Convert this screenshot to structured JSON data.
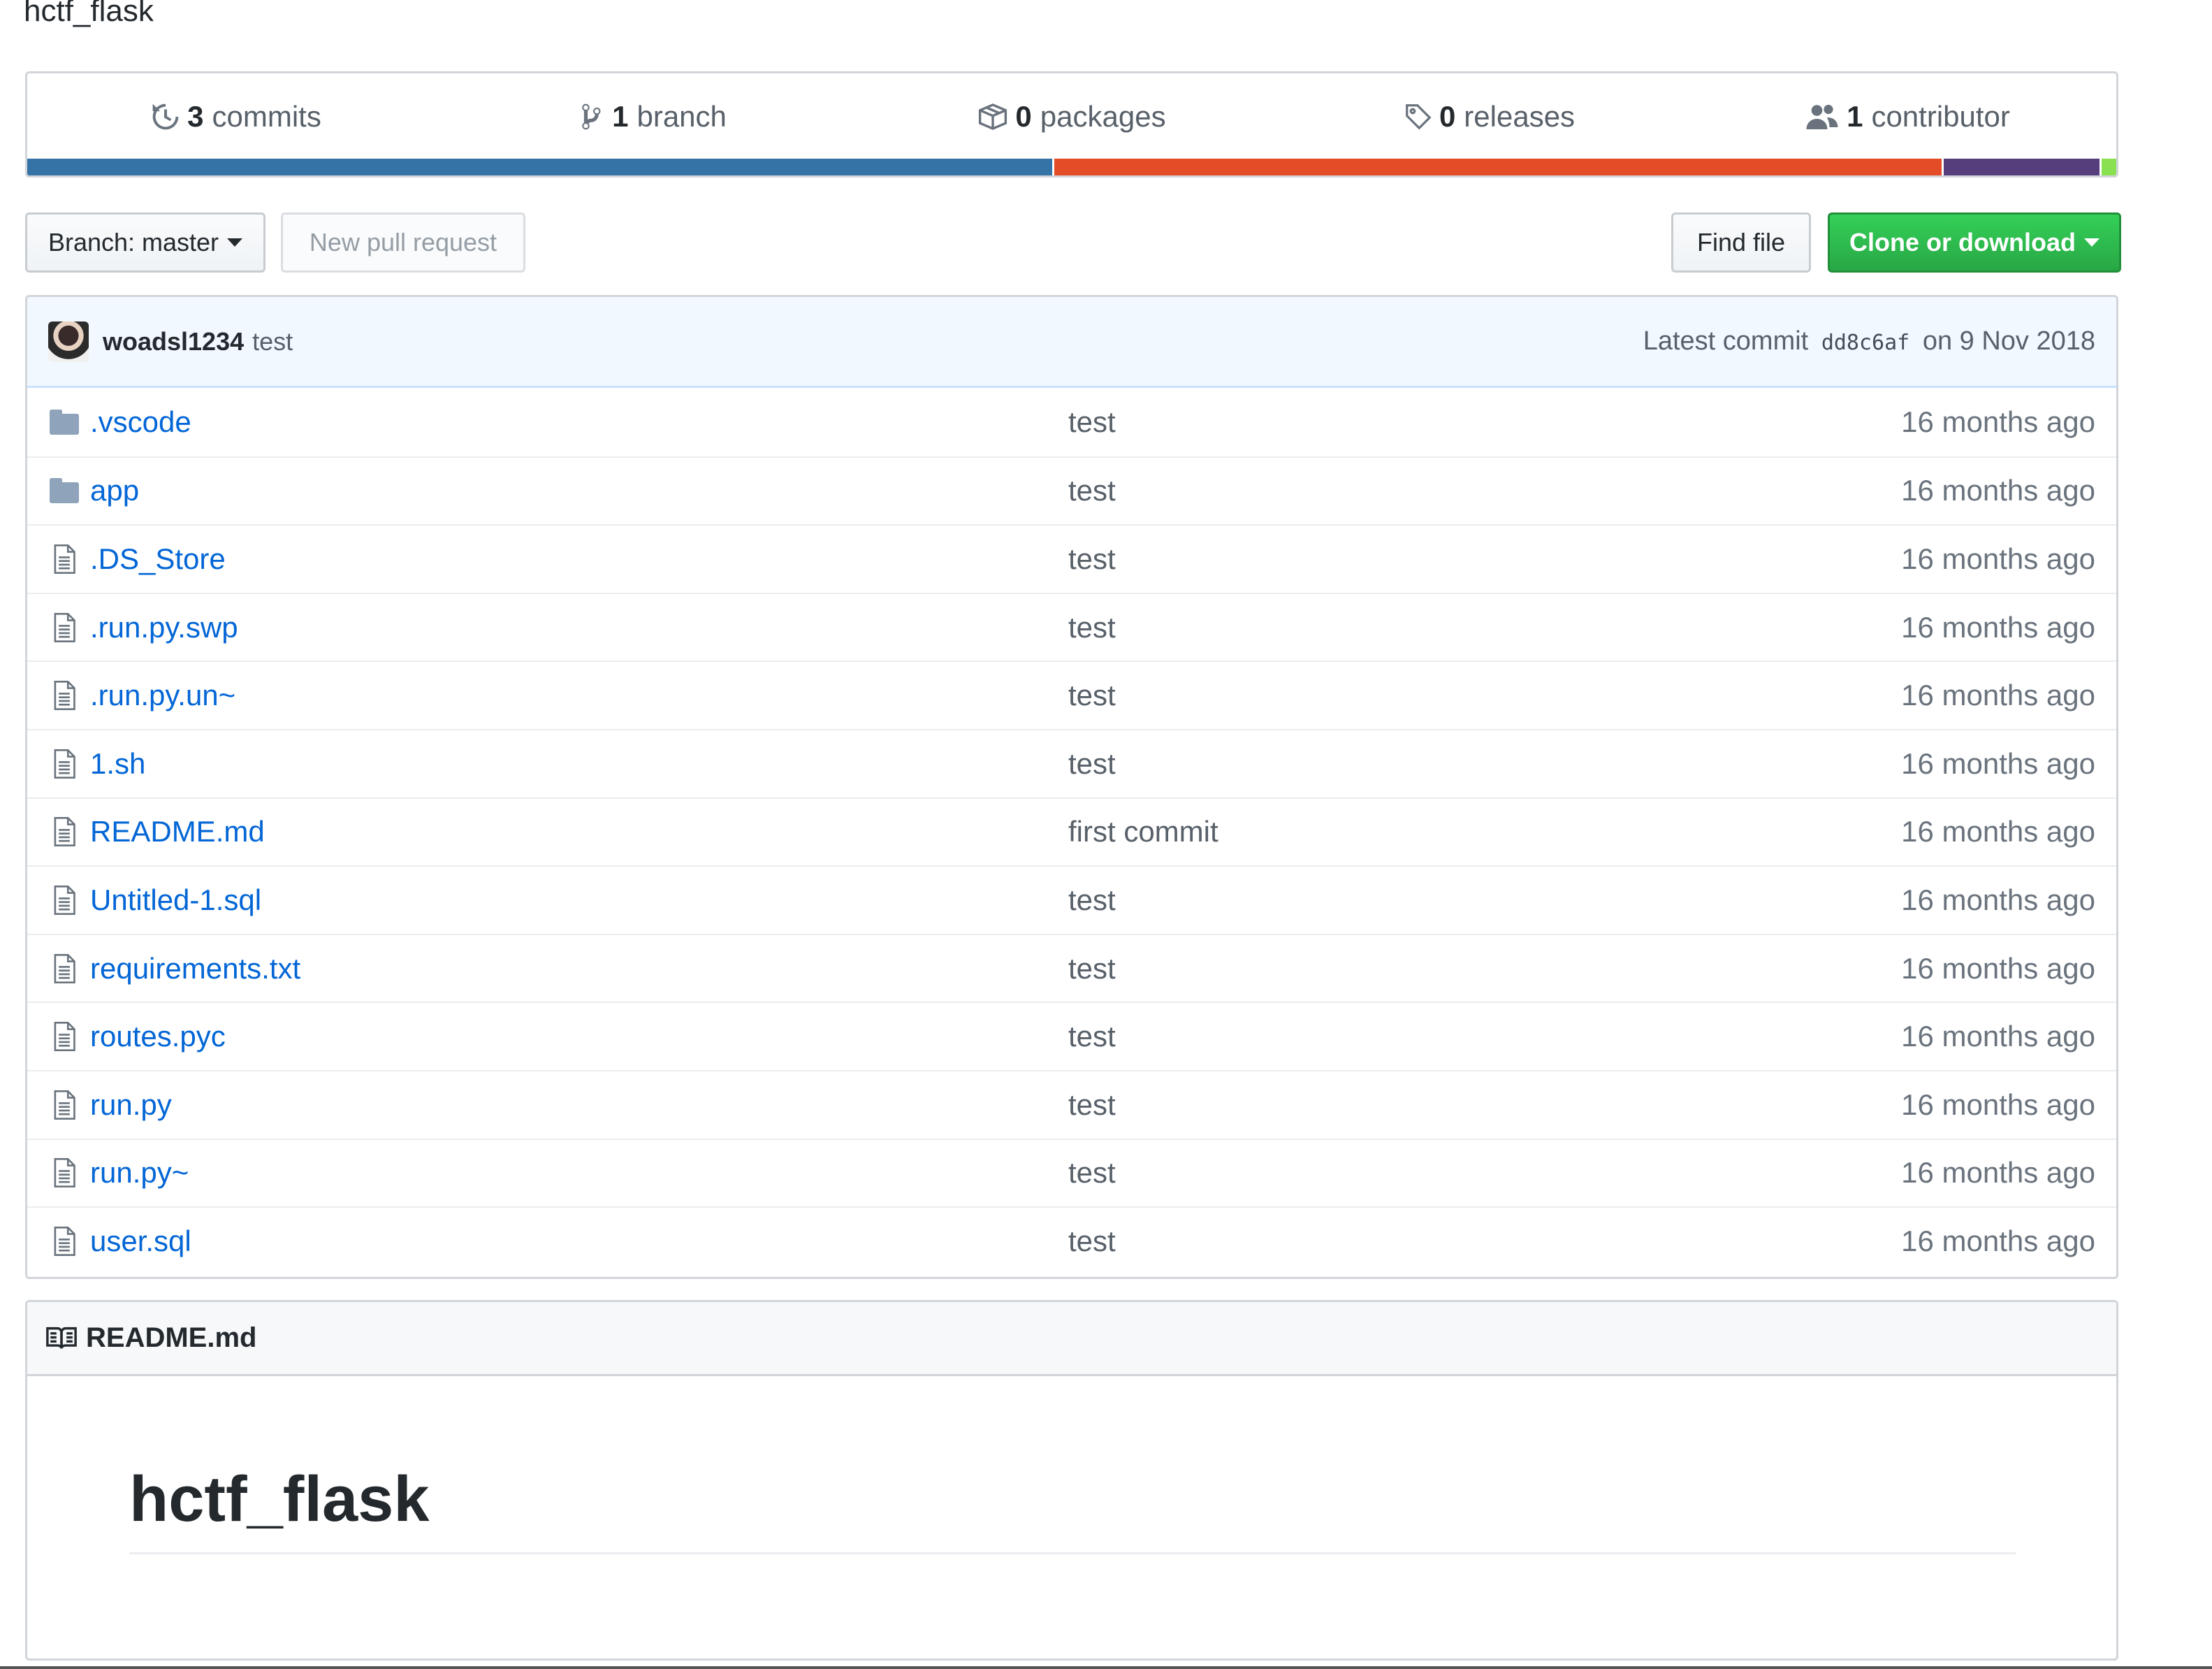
{
  "repo": {
    "description": "hctf_flask"
  },
  "summary": {
    "commits": {
      "count": "3",
      "label": "commits"
    },
    "branches": {
      "count": "1",
      "label": "branch"
    },
    "packages": {
      "count": "0",
      "label": "packages"
    },
    "releases": {
      "count": "0",
      "label": "releases"
    },
    "contributors": {
      "count": "1",
      "label": "contributor"
    }
  },
  "language_bar": [
    {
      "color": "#3572A5",
      "share": 49.2
    },
    {
      "color": "#e34c26",
      "share": 42.6
    },
    {
      "color": "#563d7c",
      "share": 7.5
    },
    {
      "color": "#89e051",
      "share": 0.7
    }
  ],
  "toolbar": {
    "branch_label": "Branch: master",
    "new_pr_label": "New pull request",
    "find_file_label": "Find file",
    "clone_label": "Clone or download"
  },
  "latest_commit": {
    "author": "woadsl1234",
    "message": "test",
    "prefix": "Latest commit",
    "sha": "dd8c6af",
    "date": "on 9 Nov 2018"
  },
  "files": [
    {
      "name": ".vscode",
      "type": "dir",
      "message": "test",
      "age": "16 months ago"
    },
    {
      "name": "app",
      "type": "dir",
      "message": "test",
      "age": "16 months ago"
    },
    {
      "name": ".DS_Store",
      "type": "file",
      "message": "test",
      "age": "16 months ago"
    },
    {
      "name": ".run.py.swp",
      "type": "file",
      "message": "test",
      "age": "16 months ago"
    },
    {
      "name": ".run.py.un~",
      "type": "file",
      "message": "test",
      "age": "16 months ago"
    },
    {
      "name": "1.sh",
      "type": "file",
      "message": "test",
      "age": "16 months ago"
    },
    {
      "name": "README.md",
      "type": "file",
      "message": "first commit",
      "age": "16 months ago"
    },
    {
      "name": "Untitled-1.sql",
      "type": "file",
      "message": "test",
      "age": "16 months ago"
    },
    {
      "name": "requirements.txt",
      "type": "file",
      "message": "test",
      "age": "16 months ago"
    },
    {
      "name": "routes.pyc",
      "type": "file",
      "message": "test",
      "age": "16 months ago"
    },
    {
      "name": "run.py",
      "type": "file",
      "message": "test",
      "age": "16 months ago"
    },
    {
      "name": "run.py~",
      "type": "file",
      "message": "test",
      "age": "16 months ago"
    },
    {
      "name": "user.sql",
      "type": "file",
      "message": "test",
      "age": "16 months ago"
    }
  ],
  "readme": {
    "filename": "README.md",
    "heading": "hctf_flask"
  },
  "icons": {
    "commits": "history-icon",
    "branch": "git-branch-icon",
    "packages": "package-icon",
    "releases": "tag-icon",
    "contributors": "people-icon",
    "dir": "folder-icon",
    "file": "file-icon",
    "readme": "book-icon"
  }
}
